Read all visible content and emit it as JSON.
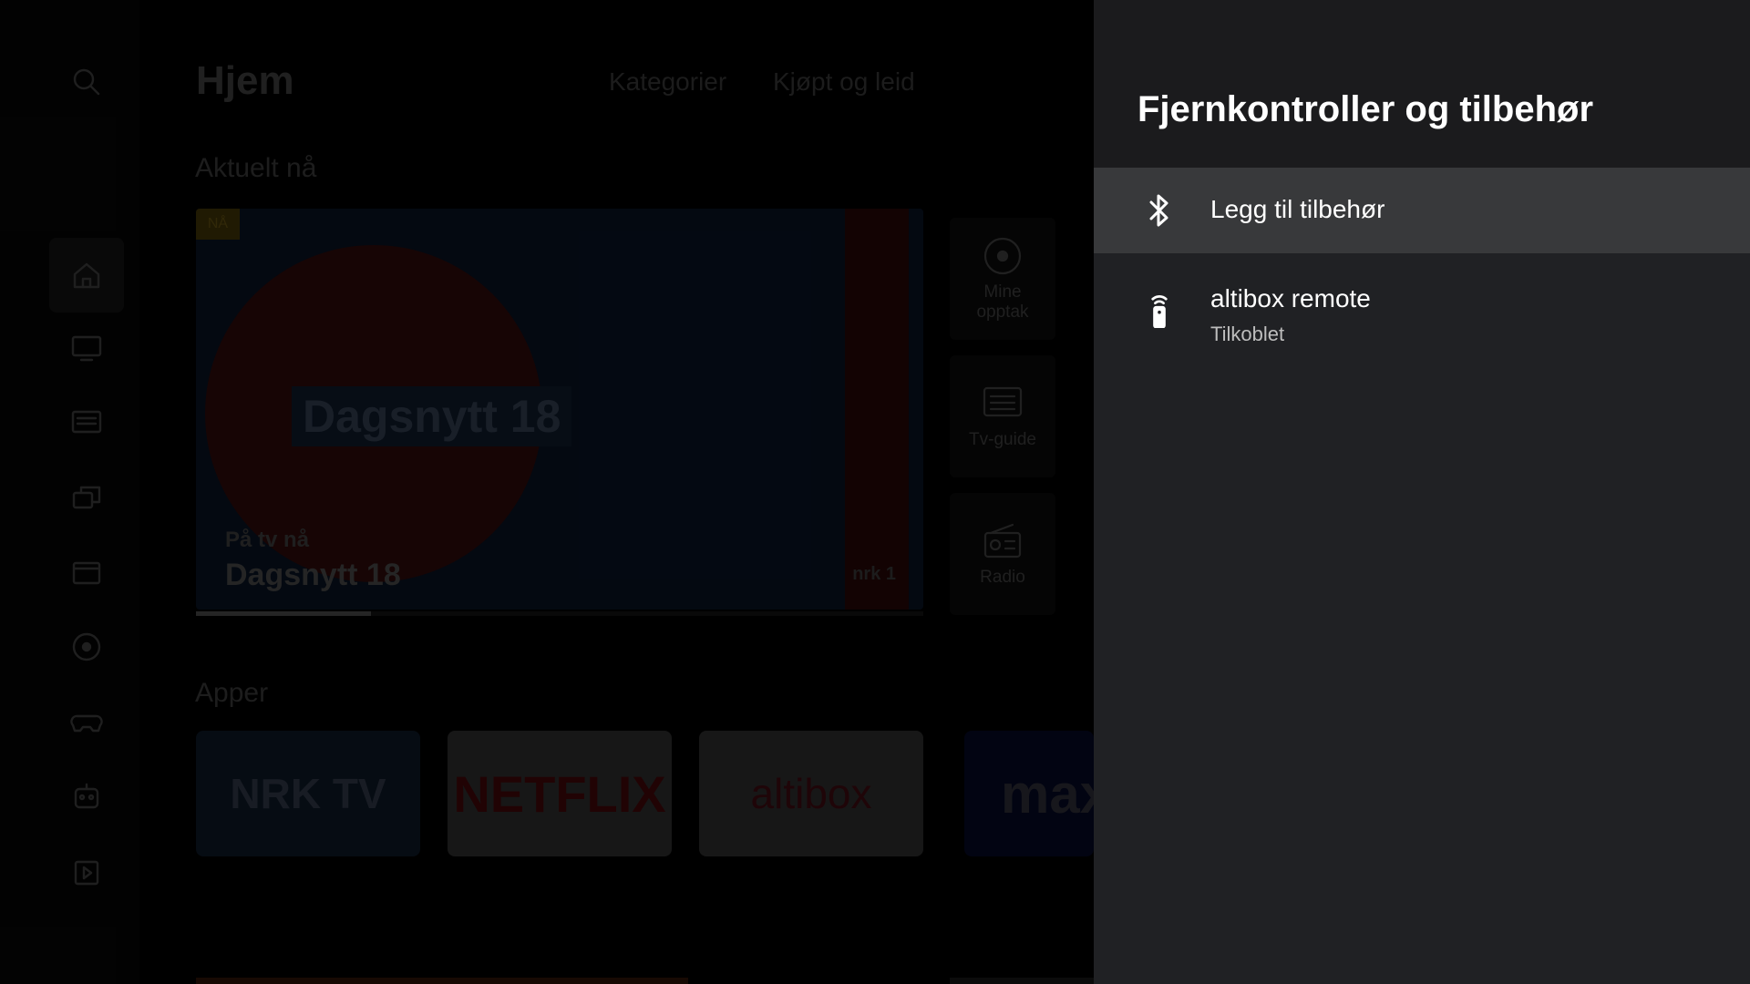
{
  "background": {
    "header": {
      "title": "Hjem",
      "links": [
        "Kategorier",
        "Kjøpt og leid"
      ]
    },
    "sections": {
      "now": "Aktuelt nå",
      "apps": "Apper"
    },
    "hero": {
      "badge": "NÅ",
      "show_title": "Dagsnytt 18",
      "on_tv_label": "På tv nå",
      "on_tv_title": "Dagsnytt 18",
      "channel_logo": "nrk 1",
      "progress": 0.24
    },
    "tiles": [
      {
        "label": "Mine opptak",
        "icon": "record-icon"
      },
      {
        "label": "Tv-guide",
        "icon": "tv-guide-icon"
      },
      {
        "label": "Radio",
        "icon": "radio-icon"
      }
    ],
    "apps": [
      "NRK TV",
      "NETFLIX",
      "altibox",
      "max"
    ],
    "rail_icons": [
      "search-icon",
      "home-icon",
      "tv-icon",
      "guide-icon",
      "library-icon",
      "movie-icon",
      "record-icon",
      "gamepad-icon",
      "robot-icon",
      "play-icon"
    ]
  },
  "panel": {
    "title": "Fjernkontroller og tilbehør",
    "items": [
      {
        "label": "Legg til tilbehør",
        "icon": "bluetooth-icon",
        "focused": true
      },
      {
        "label": "altibox remote",
        "status": "Tilkoblet",
        "icon": "remote-icon"
      }
    ]
  },
  "colors": {
    "panel_bg": "#202124",
    "focus_bg": "#38393b"
  }
}
